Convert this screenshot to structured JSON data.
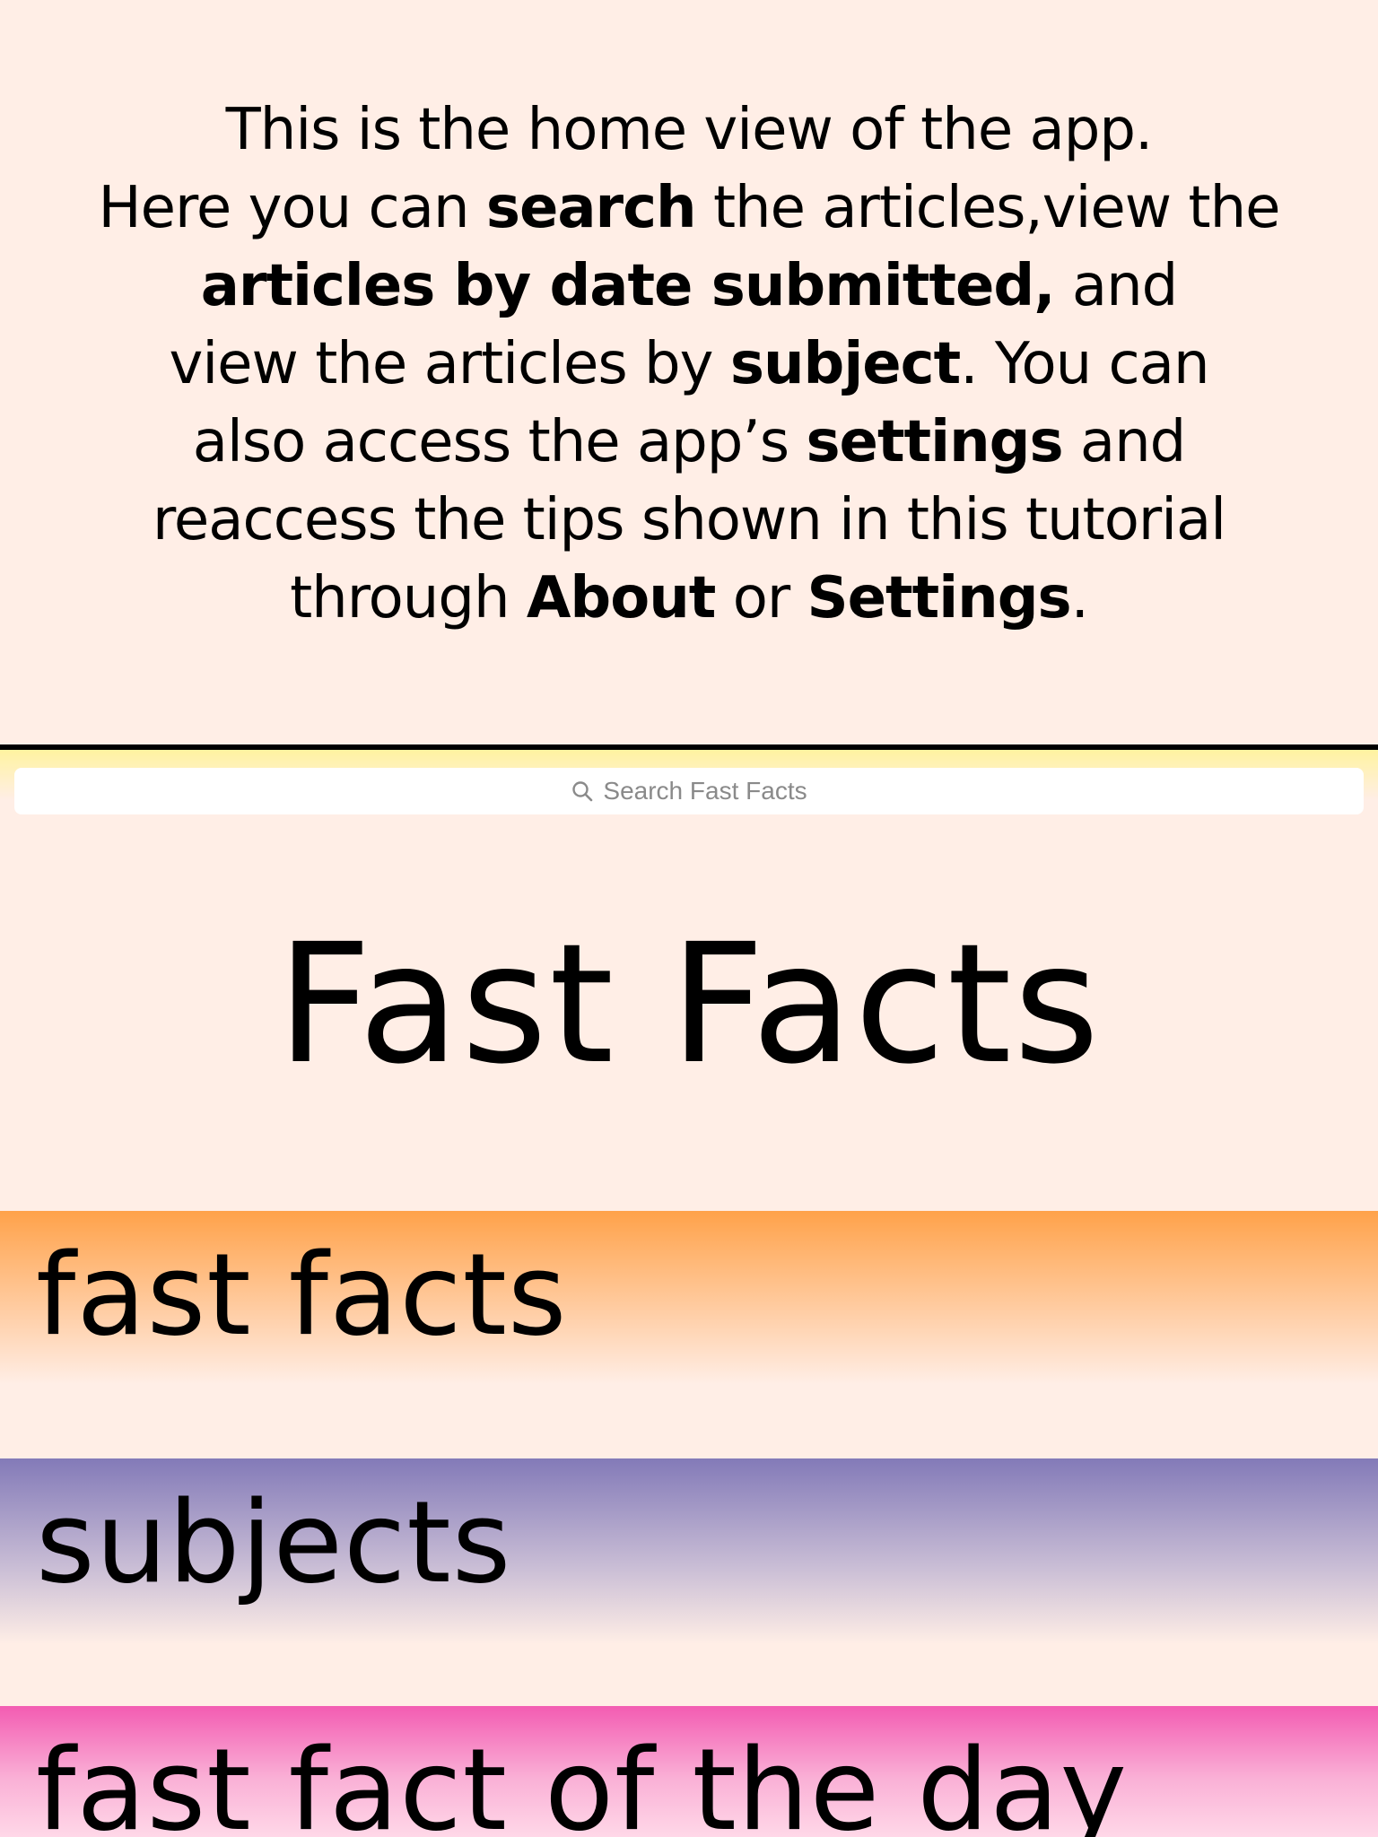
{
  "tutorial": {
    "line1": "This is the home view of the app.",
    "line2_prefix": "Here you can ",
    "line2_bold": "search",
    "line2_suffix": " the articles,view the",
    "line3_bold": "articles by date submitted,",
    "line3_suffix": " and",
    "line4_prefix": "view the articles by ",
    "line4_bold": "subject",
    "line4_suffix": ". You can",
    "line5_prefix": "also access the app’s ",
    "line5_bold": "settings",
    "line5_suffix": " and",
    "line6": "reaccess the tips shown in this tutorial",
    "line7_prefix": "through ",
    "line7_bold1": "About",
    "line7_mid": " or ",
    "line7_bold2": "Settings",
    "line7_suffix": "."
  },
  "search": {
    "placeholder": "Search Fast Facts",
    "icon": "magnifying-glass"
  },
  "app": {
    "title": "Fast Facts"
  },
  "sections": {
    "fast_facts": "fast facts",
    "subjects": "subjects",
    "fact_of_the_day": "fast fact of the day"
  },
  "colors": {
    "background": "#ffeee6",
    "search_bar_tint": "#fff3a0",
    "fast_facts_accent": "#ffa24a",
    "subjects_accent": "#837ab8",
    "fact_of_day_accent": "#f35cb2"
  }
}
